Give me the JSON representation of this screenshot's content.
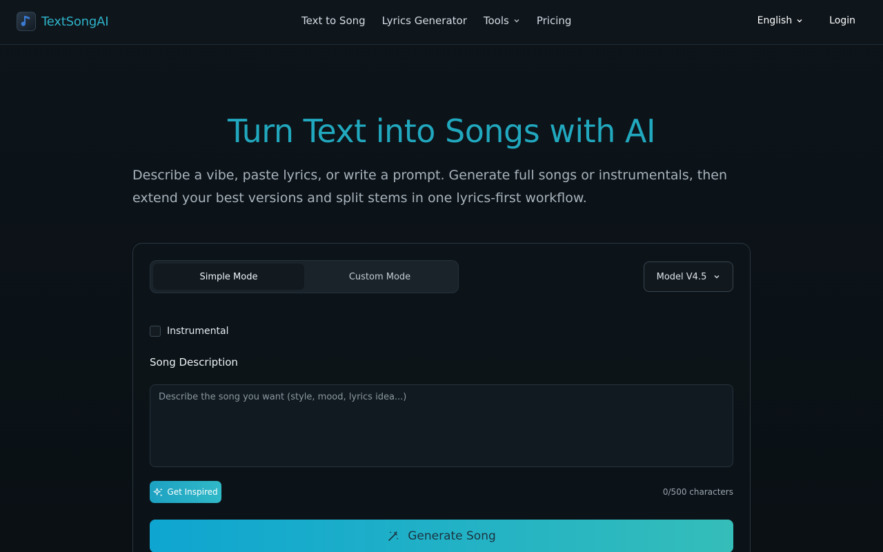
{
  "brand": {
    "name": "TextSongAI",
    "logo_icon": "music-note-icon"
  },
  "nav": {
    "links": [
      {
        "label": "Text to Song"
      },
      {
        "label": "Lyrics Generator"
      },
      {
        "label": "Tools",
        "has_dropdown": true
      },
      {
        "label": "Pricing"
      }
    ],
    "language": "English",
    "login": "Login"
  },
  "hero": {
    "title": "Turn Text into Songs with AI",
    "subtitle": "Describe a vibe, paste lyrics, or write a prompt. Generate full songs or instrumentals, then extend your best versions and split stems in one lyrics-first workflow."
  },
  "form": {
    "modes": [
      {
        "label": "Simple Mode",
        "active": true
      },
      {
        "label": "Custom Mode",
        "active": false
      }
    ],
    "model": "Model V4.5",
    "instrumental_label": "Instrumental",
    "instrumental_checked": false,
    "description_label": "Song Description",
    "description_placeholder": "Describe the song you want (style, mood, lyrics idea...)",
    "description_value": "",
    "inspire_label": "Get Inspired",
    "char_count": "0/500 characters",
    "generate_label": "Generate Song"
  },
  "colors": {
    "accent": "#21a8be",
    "background": "#0d141a",
    "button_gradient_start": "#0ea5d0",
    "button_gradient_end": "#34bdb9"
  }
}
